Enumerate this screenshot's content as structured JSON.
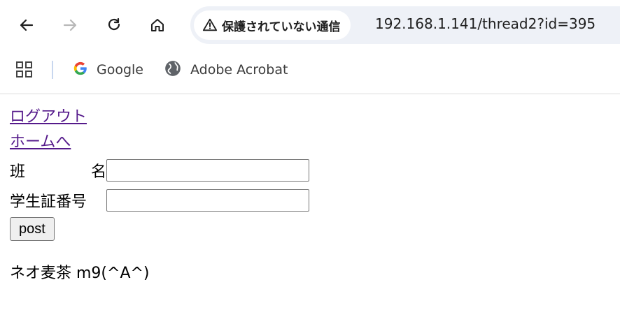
{
  "browser": {
    "security_chip": "保護されていない通信",
    "url": "192.168.1.141/thread2?id=395",
    "bookmarks": [
      {
        "label": "Google",
        "icon": "google-icon"
      },
      {
        "label": "Adobe Acrobat",
        "icon": "globe-icon"
      }
    ]
  },
  "page": {
    "logout_link": "ログアウト",
    "home_link": "ホームへ",
    "group_label_part1": "班",
    "group_label_part2": "名",
    "student_id_label": "学生証番号",
    "group_input_value": "",
    "student_id_input_value": "",
    "post_button": "post",
    "message": "ネオ麦茶 m9(^A^)"
  },
  "colors": {
    "visited_link": "#551a8b",
    "omnibox_bg": "#eef1f7"
  }
}
